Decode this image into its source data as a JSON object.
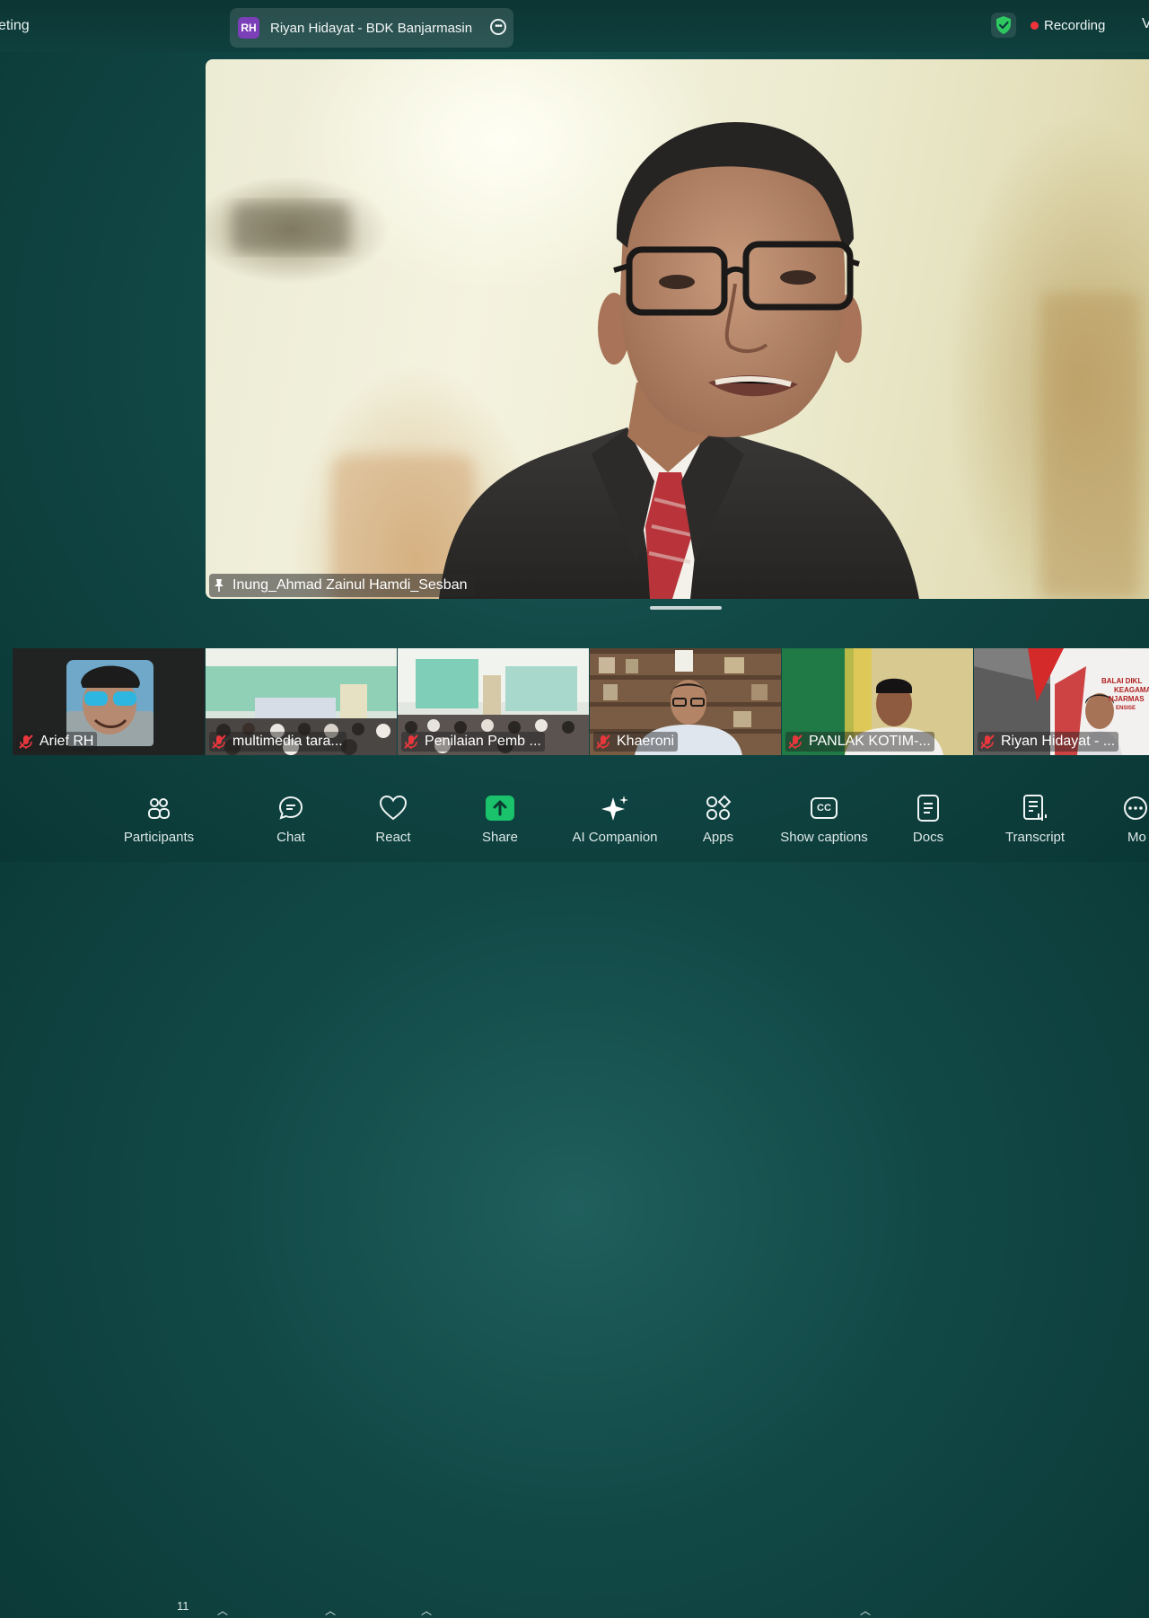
{
  "topbar": {
    "meeting_label": "eting",
    "host_initials": "RH",
    "host_name": "Riyan Hidayat - BDK Banjarmasin",
    "recording_label": "Recording",
    "view_label": "V"
  },
  "speaker": {
    "name": "Inung_Ahmad Zainul Hamdi_Sesban"
  },
  "filmstrip": [
    {
      "name": "Arief RH"
    },
    {
      "name": "multimedia tara..."
    },
    {
      "name": "Penilaian Pemb ..."
    },
    {
      "name": "Khaeroni"
    },
    {
      "name": "PANLAK KOTIM-..."
    },
    {
      "name": "Riyan Hidayat - ..."
    }
  ],
  "slide_text": {
    "line1": "BALAI DIKL",
    "line2": "KEAGAMA",
    "line3": "NJARMAS",
    "line4": "ENSISE"
  },
  "toolbar": {
    "participants_label": "Participants",
    "participants_count": "11",
    "chat_label": "Chat",
    "react_label": "React",
    "share_label": "Share",
    "ai_label": "AI Companion",
    "apps_label": "Apps",
    "captions_label": "Show captions",
    "captions_icon_text": "CC",
    "docs_label": "Docs",
    "transcript_label": "Transcript",
    "more_label": "Mo"
  },
  "colors": {
    "share_green": "#19c26b",
    "recording_red": "#f0333a",
    "mute_red": "#e8373c",
    "shield_green": "#2ec860",
    "host_avatar": "#7b3fb8"
  }
}
